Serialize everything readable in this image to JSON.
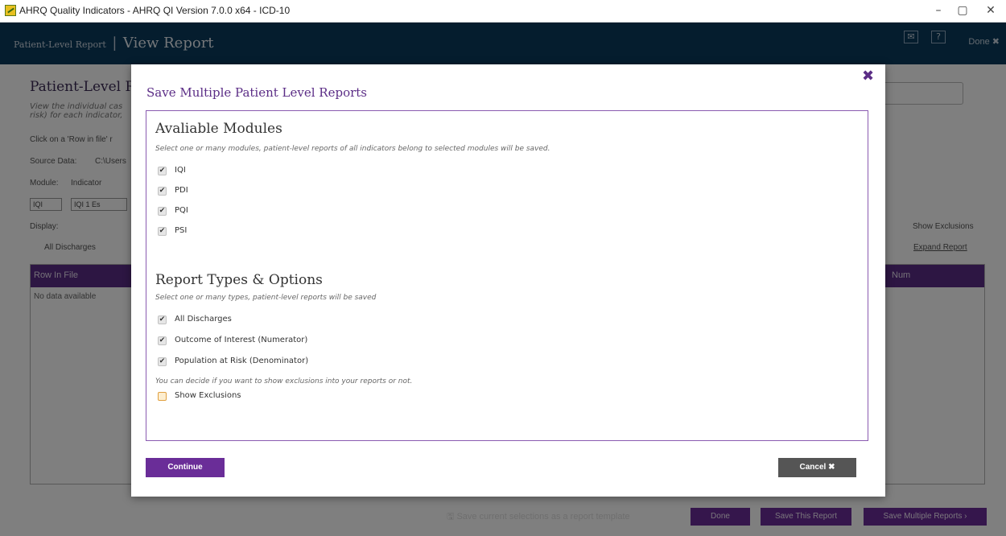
{
  "window": {
    "title": "AHRQ Quality Indicators - AHRQ QI Version 7.0.0 x64 - ICD-10",
    "minimize": "–",
    "restore": "▢",
    "close": "✕"
  },
  "header": {
    "breadcrumb_parent": "Patient-Level Report",
    "separator": "|",
    "breadcrumb_current": "View Report",
    "done_label": "Done ✖"
  },
  "background": {
    "page_title": "Patient-Level R",
    "page_subtitle": "View the individual cas risk) for each indicator,",
    "click_hint": "Click on a 'Row in file' r",
    "source_label": "Source Data:",
    "source_value": "C:\\Users",
    "module_label": "Module:",
    "indicator_label": "Indicator",
    "module_value": "IQI",
    "indicator_value": "IQI 1 Es",
    "display_label": "Display:",
    "display_option": "All Discharges",
    "show_exclusions": "Show Exclusions",
    "expand_report": "Expand Report",
    "col_row_in_file": "Row In File",
    "col_num": "Num",
    "no_data": "No data available",
    "save_template": "Save current selections as a report template",
    "done_btn": "Done",
    "save_this_btn": "Save This Report",
    "save_multiple_btn": "Save Multiple Reports ›"
  },
  "modal": {
    "title": "Save Multiple Patient Level Reports",
    "close_icon": "✖",
    "modules_heading": "Avaliable Modules",
    "modules_hint": "Select one or many modules, patient-level reports of all indicators belong to selected modules will be saved.",
    "modules": [
      {
        "label": "IQI",
        "checked": true
      },
      {
        "label": "PDI",
        "checked": true
      },
      {
        "label": "PQI",
        "checked": true
      },
      {
        "label": "PSI",
        "checked": true
      }
    ],
    "types_heading": "Report Types & Options",
    "types_hint": "Select one or many types, patient-level reports will be saved",
    "types": [
      {
        "label": "All Discharges",
        "checked": true
      },
      {
        "label": "Outcome of Interest (Numerator)",
        "checked": true
      },
      {
        "label": "Population at Risk (Denominator)",
        "checked": true
      }
    ],
    "exclusions_hint": "You can decide if you want to show exclusions into your reports or not.",
    "show_exclusions": {
      "label": "Show Exclusions",
      "checked": false
    },
    "continue_label": "Continue",
    "cancel_label": "Cancel ✖"
  }
}
